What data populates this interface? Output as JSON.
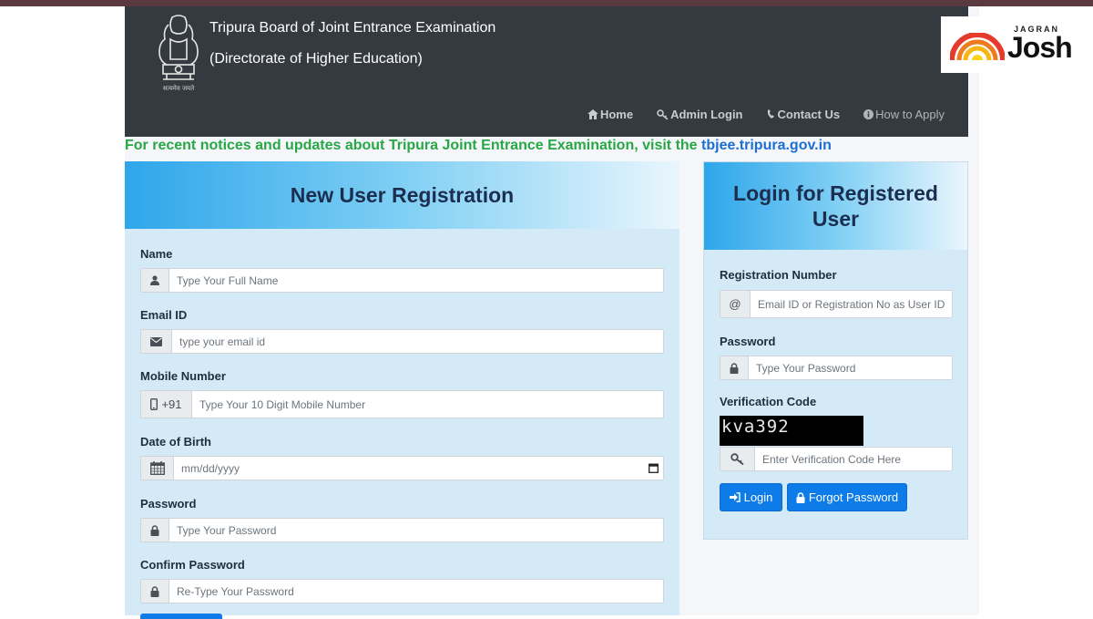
{
  "header": {
    "org_line1": "Tripura Board of Joint Entrance Examination",
    "org_line2": "(Directorate of Higher Education)",
    "emblem_caption": "सत्यमेव जयते",
    "nav": [
      {
        "label": "Home",
        "icon": "home-icon"
      },
      {
        "label": "Admin Login",
        "icon": "key-icon"
      },
      {
        "label": "Contact Us",
        "icon": "phone-icon"
      },
      {
        "label": "How to Apply",
        "icon": "info-icon"
      }
    ]
  },
  "notice": {
    "text": "For recent notices and updates about Tripura Joint Entrance Examination, visit the ",
    "link": "tbjee.tripura.gov.in"
  },
  "registration": {
    "title": "New User Registration",
    "name_label": "Name",
    "name_placeholder": "Type Your Full Name",
    "email_label": "Email ID",
    "email_placeholder": "type your email id",
    "mobile_label": "Mobile Number",
    "mobile_prefix": "+91",
    "mobile_placeholder": "Type Your 10 Digit Mobile Number",
    "dob_label": "Date of Birth",
    "dob_placeholder": "mm/dd/yyyy",
    "password_label": "Password",
    "password_placeholder": "Type Your Password",
    "confirm_label": "Confirm Password",
    "confirm_placeholder": "Re-Type Your Password"
  },
  "login": {
    "title": "Login for Registered User",
    "reg_label": "Registration Number",
    "reg_addon": "@",
    "reg_placeholder": "Email ID or Registration No as User ID",
    "password_label": "Password",
    "password_placeholder": "Type Your Password",
    "verify_label": "Verification Code",
    "captcha": "kva392",
    "verify_placeholder": "Enter Verification Code Here",
    "login_button": "Login",
    "forgot_button": "Forgot Password"
  },
  "logo": {
    "top": "JAGRAN",
    "main": "Josh"
  }
}
